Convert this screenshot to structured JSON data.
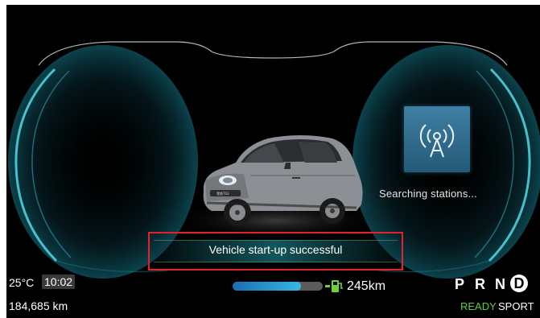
{
  "cluster": {
    "status_message": "Vehicle start-up successful",
    "station_status": "Searching  stations...",
    "temperature": "25°C",
    "time": "10:02",
    "odometer": "184,685 km",
    "range": "245km",
    "battery_level_fraction": 0.76,
    "gear_p": "P",
    "gear_r": "R",
    "gear_n": "N",
    "gear_d": "D",
    "active_gear": "D",
    "ready_label": "READY",
    "drive_mode": "SPORT",
    "icons": [
      "antenna-signal-icon",
      "charger-icon"
    ],
    "colors": {
      "background": "#000000",
      "frame_glow": "#3fb8c6",
      "alert_border": "#e5222c",
      "battery_fill": "#37b6e6",
      "charger": "#6fd13a",
      "ready": "#5ecb3c",
      "station_tile": "#2f6d8e"
    }
  }
}
